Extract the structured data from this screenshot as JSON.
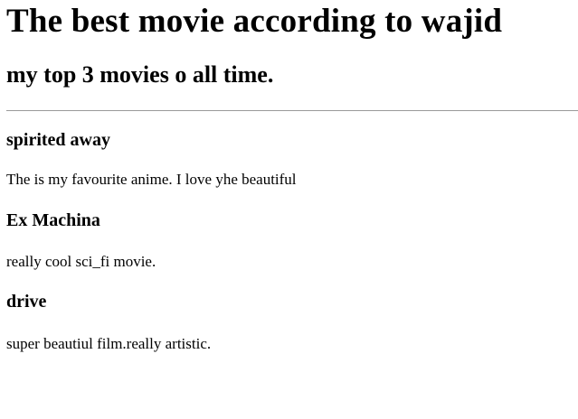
{
  "page": {
    "title": "The best movie according to wajid",
    "subtitle": "my top 3 movies o all time."
  },
  "movies": [
    {
      "name": "spirited away",
      "description": "The is my favourite anime. I love yhe beautiful"
    },
    {
      "name": "Ex Machina",
      "description": "really cool sci_fi movie."
    },
    {
      "name": "drive",
      "description": "super beautiul film.really artistic."
    }
  ]
}
